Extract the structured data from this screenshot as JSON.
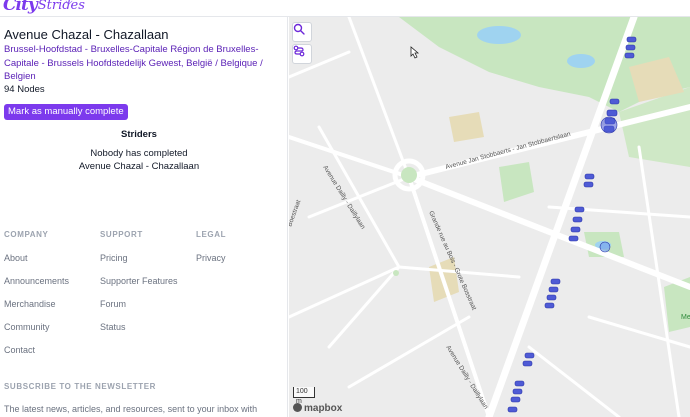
{
  "app": {
    "logo_text": "City",
    "logo_text2": "Strides"
  },
  "street": {
    "title": "Avenue Chazal - Chazallaan",
    "region": "Brussel-Hoofdstad - Bruxelles-Capitale Région de Bruxelles-Capitale - Brussels Hoofdstedelijk Gewest, België / Belgique / Belgien",
    "nodes": "94 Nodes",
    "mark_button": "Mark as manually complete"
  },
  "striders": {
    "heading": "Striders",
    "line1": "Nobody has completed",
    "line2": "Avenue Chazal - Chazallaan"
  },
  "footer": {
    "company": {
      "heading": "COMPANY",
      "links": [
        "About",
        "Announcements",
        "Merchandise",
        "Community",
        "Contact"
      ]
    },
    "support": {
      "heading": "SUPPORT",
      "links": [
        "Pricing",
        "Supporter Features",
        "Forum",
        "Status"
      ]
    },
    "legal": {
      "heading": "LEGAL",
      "links": [
        "Privacy"
      ]
    },
    "newsletter_heading": "SUBSCRIBE TO THE NEWSLETTER",
    "newsletter_text": "The latest news, articles, and resources, sent to your inbox with"
  },
  "map": {
    "street_labels": [
      "Avenue Jan Stobbaerts - Jan Stobbaertslaan",
      "Avenue Dailly - Daillylaan",
      "Grande rue au Bois - Grote Bosstraat",
      "Avenue Dailly - Daillylaan",
      "Boestraat"
    ],
    "scale_label": "100 m",
    "attribution": "mapbox",
    "edge_letter": "Me",
    "colors": {
      "node": "#4f5bd5",
      "park": "#c8e6c0",
      "water": "#9fd3f0",
      "road": "#ffffff",
      "background": "#ececec"
    }
  }
}
